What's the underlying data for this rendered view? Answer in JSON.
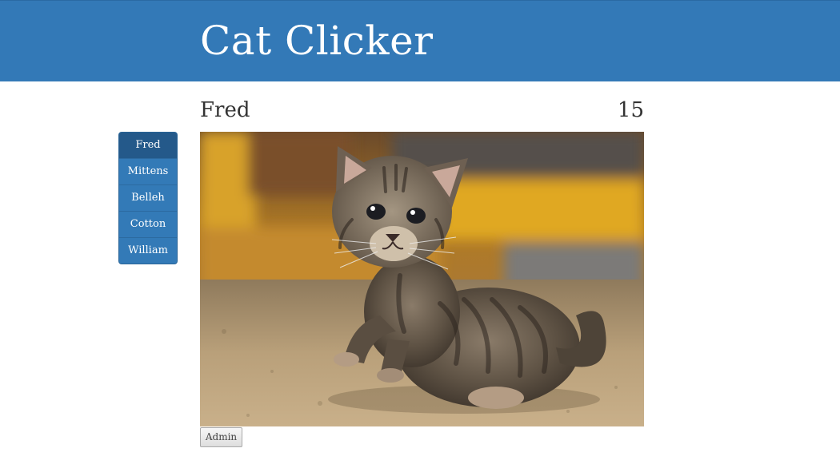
{
  "header": {
    "title": "Cat Clicker"
  },
  "cat_list": {
    "items": [
      {
        "label": "Fred",
        "active": true
      },
      {
        "label": "Mittens",
        "active": false
      },
      {
        "label": "Belleh",
        "active": false
      },
      {
        "label": "Cotton",
        "active": false
      },
      {
        "label": "William",
        "active": false
      }
    ]
  },
  "current_cat": {
    "name": "Fred",
    "count": "15",
    "image_icon": "tabby-kitten-photo"
  },
  "admin": {
    "button_label": "Admin"
  },
  "colors": {
    "header_bg": "#3379b7",
    "list_bg": "#337ab7",
    "list_active_bg": "#24598a",
    "text": "#333333"
  }
}
